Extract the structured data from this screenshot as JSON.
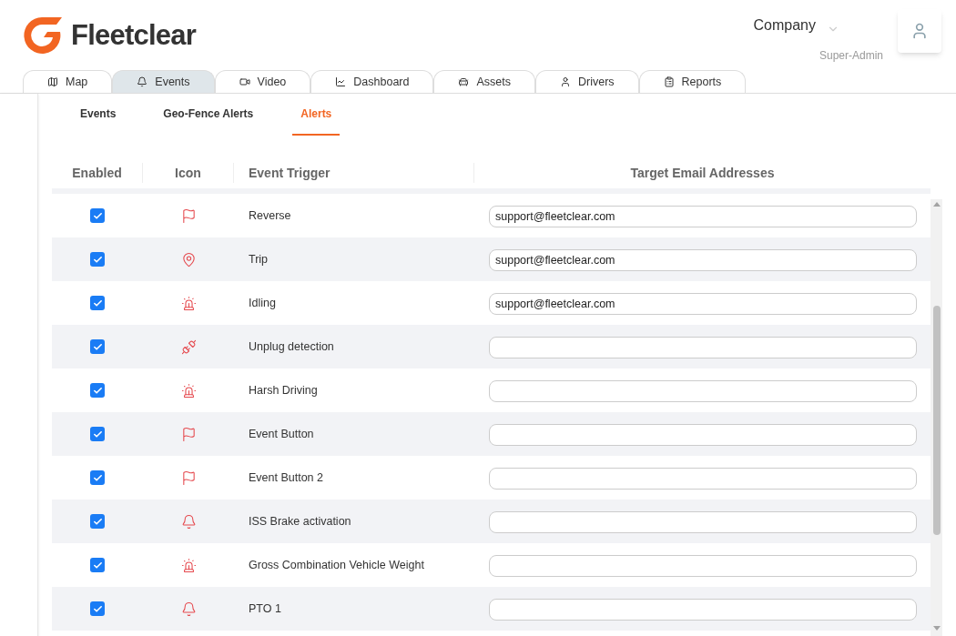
{
  "header": {
    "brand": "Fleetclear",
    "company": "Company",
    "role": "Super-Admin"
  },
  "nav_tabs": [
    {
      "label": "Map",
      "selected": false
    },
    {
      "label": "Events",
      "selected": true
    },
    {
      "label": "Video",
      "selected": false
    },
    {
      "label": "Dashboard",
      "selected": false
    },
    {
      "label": "Assets",
      "selected": false
    },
    {
      "label": "Drivers",
      "selected": false
    },
    {
      "label": "Reports",
      "selected": false
    }
  ],
  "sub_tabs": [
    {
      "label": "Events",
      "selected": false
    },
    {
      "label": "Geo-Fence Alerts",
      "selected": false
    },
    {
      "label": "Alerts",
      "selected": true
    }
  ],
  "table": {
    "columns": [
      "Enabled",
      "Icon",
      "Event Trigger",
      "Target Email Addresses"
    ],
    "rows": [
      {
        "enabled": true,
        "kind": "flag",
        "trigger": "Reverse",
        "email": "support@fleetclear.com"
      },
      {
        "enabled": true,
        "kind": "pin",
        "trigger": "Trip",
        "email": "support@fleetclear.com"
      },
      {
        "enabled": true,
        "kind": "siren",
        "trigger": "Idling",
        "email": "support@fleetclear.com"
      },
      {
        "enabled": true,
        "kind": "plug",
        "trigger": "Unplug detection"
      },
      {
        "enabled": true,
        "kind": "siren",
        "trigger": "Harsh Driving"
      },
      {
        "enabled": true,
        "kind": "flag",
        "trigger": "Event Button"
      },
      {
        "enabled": true,
        "kind": "flag",
        "trigger": "Event Button 2"
      },
      {
        "enabled": true,
        "kind": "bell",
        "trigger": "ISS Brake activation"
      },
      {
        "enabled": true,
        "kind": "siren",
        "trigger": "Gross Combination Vehicle Weight"
      },
      {
        "enabled": true,
        "kind": "bell",
        "trigger": "PTO 1"
      }
    ]
  }
}
